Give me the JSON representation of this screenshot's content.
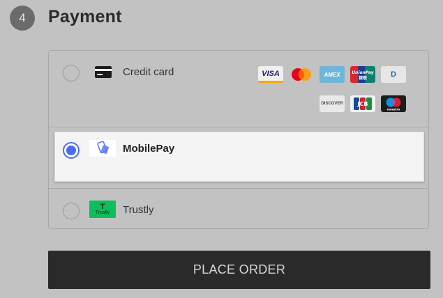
{
  "section": {
    "step_number": "4",
    "title": "Payment"
  },
  "methods": {
    "credit_card": {
      "label": "Credit card",
      "selected": false,
      "card_logos": [
        {
          "name": "visa-logo",
          "text": "VISA",
          "bg": "#f0f0f0",
          "fg": "#1a1f71",
          "border": "#f6a800"
        },
        {
          "name": "mastercard-logo",
          "text": "",
          "bg": "#c2c2c2"
        },
        {
          "name": "amex-logo",
          "text": "AMEX",
          "bg": "#6bb6d9",
          "fg": "#ffffff"
        },
        {
          "name": "unionpay-logo",
          "text": "UnionPay 银联",
          "bg": "#ffffff"
        },
        {
          "name": "diners-logo",
          "text": "D",
          "bg": "#e6e6e6",
          "fg": "#1a6fb0"
        },
        {
          "name": "discover-logo",
          "text": "DISCOVER",
          "bg": "#e9e9e9",
          "fg": "#444444"
        },
        {
          "name": "jcb-logo",
          "text": "JCB",
          "bg": "#ffffff"
        },
        {
          "name": "maestro-logo",
          "text": "maestro",
          "bg": "#1c1c1c",
          "fg": "#ffffff"
        }
      ]
    },
    "mobilepay": {
      "label": "MobilePay",
      "selected": true
    },
    "trustly": {
      "label": "Trustly",
      "logo_text": "Trustly",
      "selected": false
    }
  },
  "actions": {
    "place_order_label": "PLACE ORDER"
  },
  "colors": {
    "accent": "#4a6cf0",
    "button_bg": "#2a2a2a",
    "trustly_green": "#0ee06e"
  }
}
